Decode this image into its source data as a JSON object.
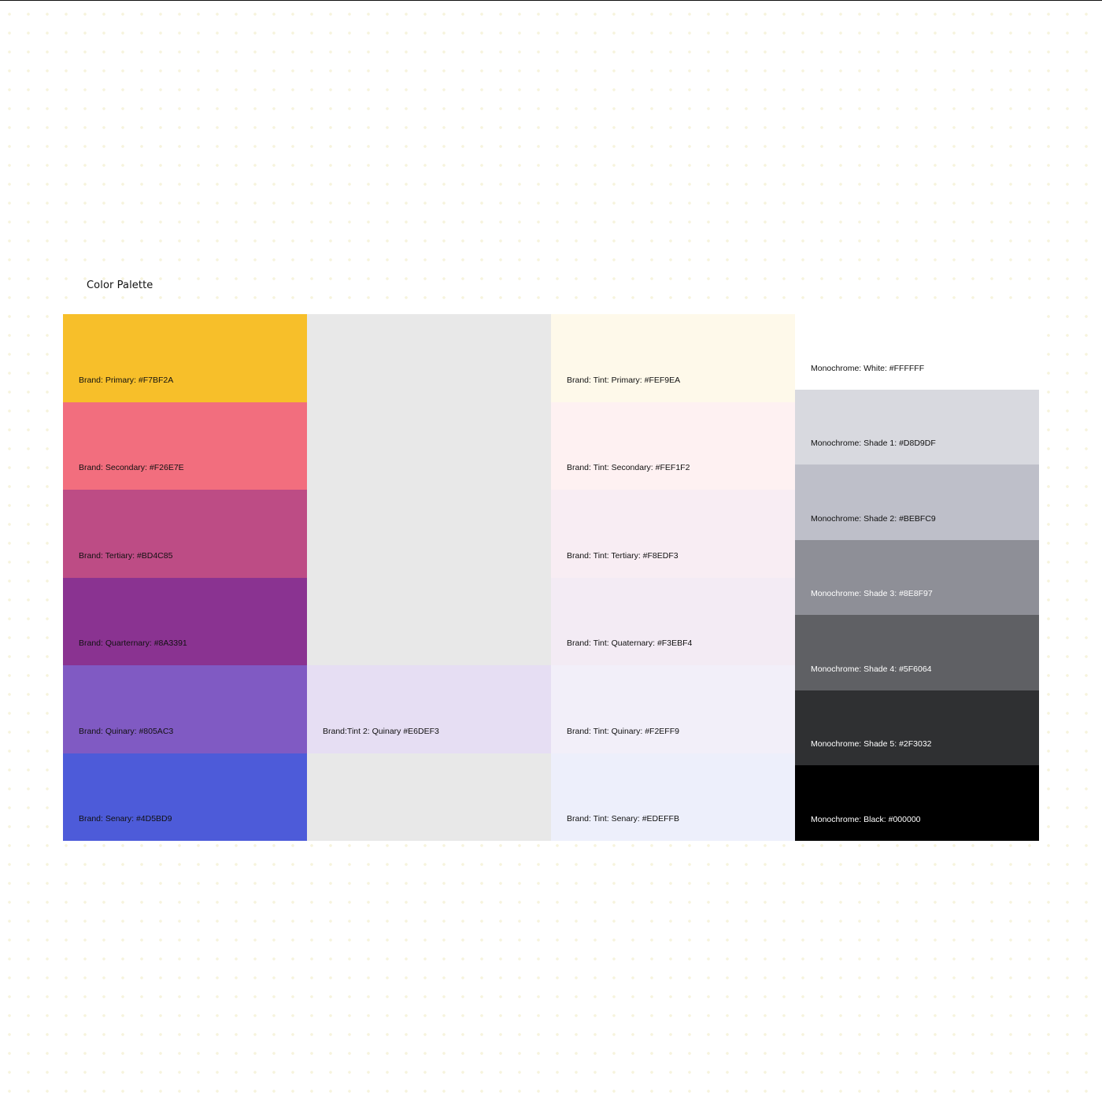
{
  "title": "Color Palette",
  "brand": [
    {
      "label": "Brand: Primary: #F7BF2A",
      "color": "#F7BF2A"
    },
    {
      "label": "Brand: Secondary: #F26E7E",
      "color": "#F26E7E"
    },
    {
      "label": "Brand: Tertiary: #BD4C85",
      "color": "#BD4C85"
    },
    {
      "label": "Brand: Quarternary: #8A3391",
      "color": "#8A3391"
    },
    {
      "label": "Brand: Quinary: #805AC3",
      "color": "#805AC3"
    },
    {
      "label": "Brand: Senary: #4D5BD9",
      "color": "#4D5BD9"
    }
  ],
  "tint2": {
    "label": "Brand:Tint 2: Quinary #E6DEF3",
    "color": "#E6DEF3",
    "filler_color": "#E8E8E8"
  },
  "tint": [
    {
      "label": "Brand: Tint: Primary: #FEF9EA",
      "color": "#FEF9EA"
    },
    {
      "label": "Brand: Tint: Secondary: #FEF1F2",
      "color": "#FEF1F2"
    },
    {
      "label": "Brand: Tint: Tertiary: #F8EDF3",
      "color": "#F8EDF3"
    },
    {
      "label": "Brand: Tint: Quaternary: #F3EBF4",
      "color": "#F3EBF4"
    },
    {
      "label": "Brand: Tint: Quinary: #F2EFF9",
      "color": "#F2EFF9"
    },
    {
      "label": "Brand: Tint: Senary: #EDEFFB",
      "color": "#EDEFFB"
    }
  ],
  "mono": [
    {
      "label": "Monochrome: White: #FFFFFF",
      "color": "#FFFFFF"
    },
    {
      "label": "Monochrome: Shade 1: #D8D9DF",
      "color": "#D8D9DF"
    },
    {
      "label": "Monochrome: Shade 2: #BEBFC9",
      "color": "#BEBFC9"
    },
    {
      "label": "Monochrome: Shade 3: #8E8F97",
      "color": "#8E8F97"
    },
    {
      "label": "Monochrome: Shade 4: #5F6064",
      "color": "#5F6064"
    },
    {
      "label": "Monochrome: Shade 5: #2F3032",
      "color": "#2F3032"
    },
    {
      "label": "Monochrome: Black: #000000",
      "color": "#000000"
    }
  ]
}
